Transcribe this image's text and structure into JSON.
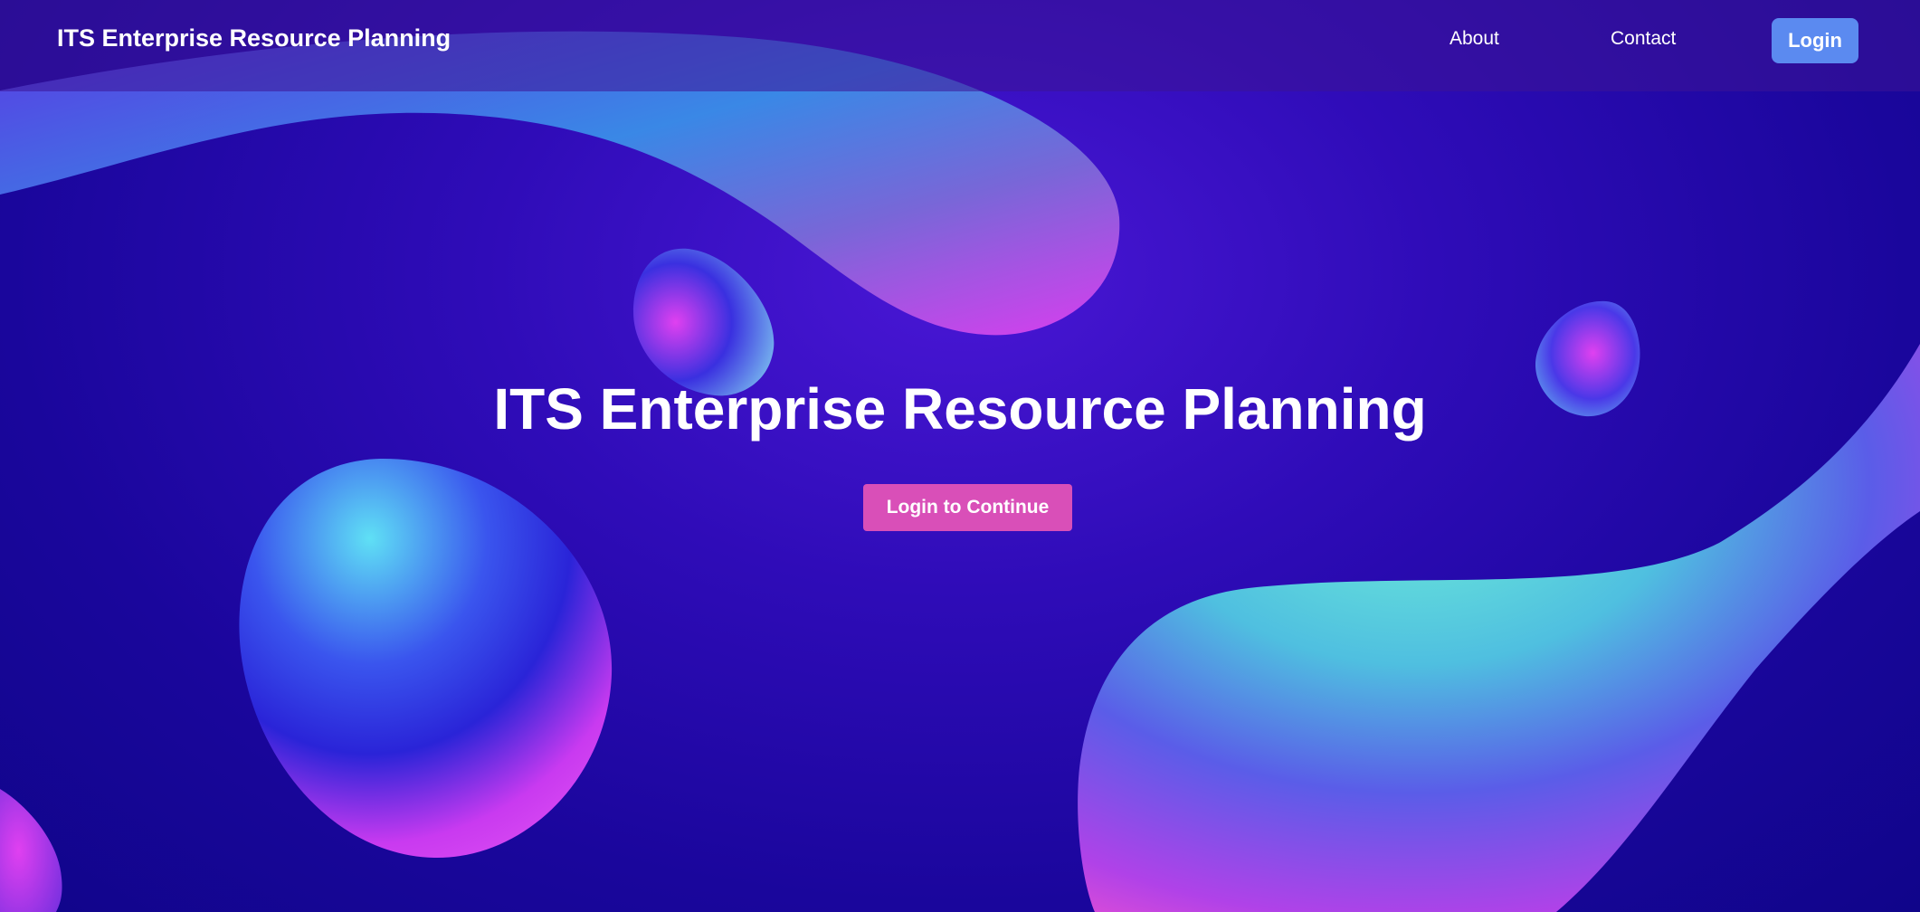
{
  "navbar": {
    "brand": "ITS Enterprise Resource Planning",
    "links": [
      {
        "label": "About"
      },
      {
        "label": "Contact"
      }
    ],
    "login_label": "Login"
  },
  "hero": {
    "title": "ITS Enterprise Resource Planning",
    "cta_label": "Login to Continue"
  },
  "colors": {
    "background": "#2f0cb8",
    "navbar_bg": "#3c1496",
    "login_button": "#5b8af0",
    "cta_button": "#d94fb8",
    "text": "#ffffff"
  }
}
